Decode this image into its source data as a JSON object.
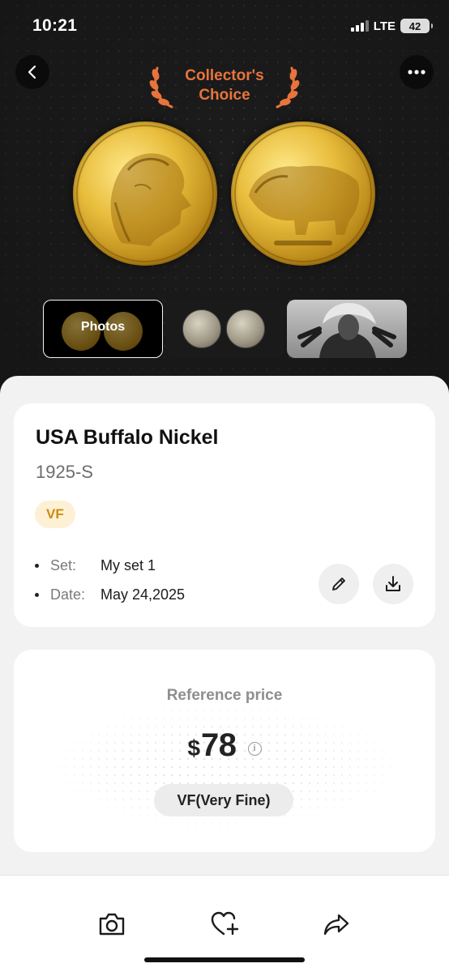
{
  "status_bar": {
    "time": "10:21",
    "network": "LTE",
    "battery": "42"
  },
  "header": {
    "back_icon": "chevron-left-icon",
    "more_icon": "ellipsis-icon",
    "badge_line1": "Collector's",
    "badge_line2": "Choice",
    "badge_color": "#e8743c"
  },
  "gallery": {
    "photos_label": "Photos"
  },
  "coin": {
    "name": "USA Buffalo Nickel",
    "year_mint": "1925-S",
    "grade_tag": "VF",
    "meta": [
      {
        "key": "Set:",
        "value": "My set 1"
      },
      {
        "key": "Date:",
        "value": "May 24,2025"
      }
    ],
    "actions": {
      "edit_icon": "pencil-icon",
      "download_icon": "download-icon"
    }
  },
  "price": {
    "label": "Reference price",
    "currency": "$",
    "value": "78",
    "info_icon": "info-icon",
    "grade": "VF(Very Fine)"
  },
  "bottom_bar": {
    "items": [
      {
        "icon": "camera-icon"
      },
      {
        "icon": "heart-plus-icon"
      },
      {
        "icon": "share-icon"
      }
    ]
  },
  "colors": {
    "hero_background": "#1c1c1c",
    "grade_tag_bg": "#fdf0d4",
    "grade_tag_text": "#c98c12"
  }
}
